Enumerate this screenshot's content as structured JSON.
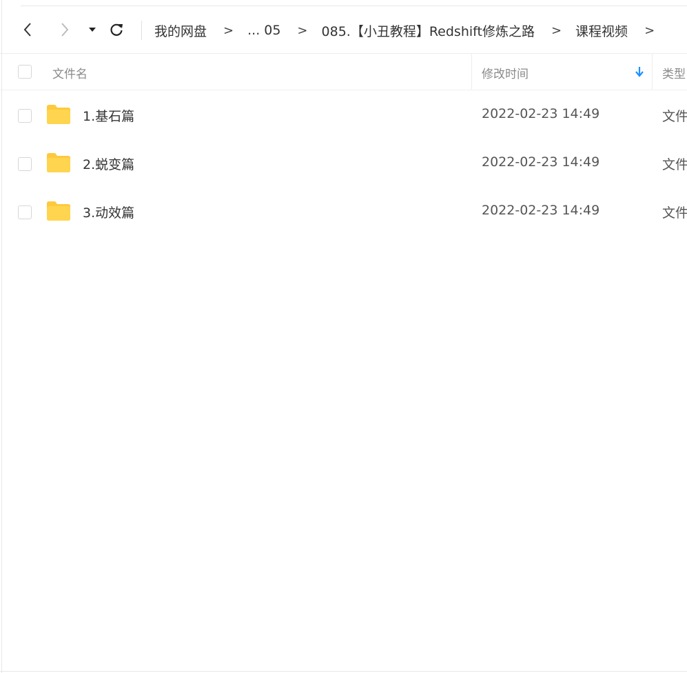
{
  "toolbar": {
    "back_icon": "chevron-left-icon",
    "forward_icon": "chevron-right-icon",
    "history_icon": "caret-down-icon",
    "refresh_icon": "refresh-icon"
  },
  "breadcrumb": {
    "items": [
      "我的网盘",
      "...",
      "05",
      "085.【小丑教程】Redshift修炼之路",
      "课程视频"
    ],
    "separator": ">"
  },
  "list": {
    "columns": {
      "name": "文件名",
      "modified": "修改时间",
      "type": "类型"
    },
    "sort_icon": "arrow-down-icon",
    "rows": [
      {
        "name": "1.基石篇",
        "modified": "2022-02-23 14:49",
        "type": "文件夹"
      },
      {
        "name": "2.蜕变篇",
        "modified": "2022-02-23 14:49",
        "type": "文件夹"
      },
      {
        "name": "3.动效篇",
        "modified": "2022-02-23 14:49",
        "type": "文件夹"
      }
    ]
  },
  "colors": {
    "accent": "#1e90ff",
    "folder": "#ffc93c"
  }
}
